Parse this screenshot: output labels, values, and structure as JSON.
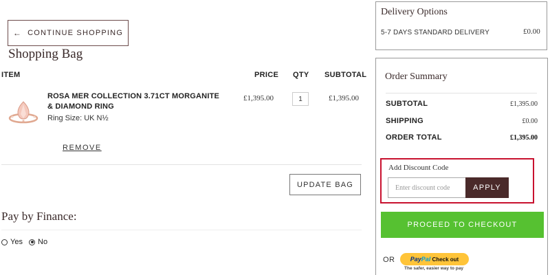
{
  "left": {
    "continue_label": "CONTINUE SHOPPING",
    "title": "Shopping Bag",
    "headers": {
      "item": "ITEM",
      "price": "PRICE",
      "qty": "QTY",
      "subtotal": "SUBTOTAL"
    },
    "item": {
      "name": "ROSA MER COLLECTION 3.71CT MORGANITE & DIAMOND RING",
      "ring_size": "Ring Size:  UK N½",
      "price": "£1,395.00",
      "qty": "1",
      "subtotal": "£1,395.00",
      "remove_label": "REMOVE"
    },
    "update_label": "UPDATE BAG",
    "finance_title": "Pay by Finance:",
    "finance_options": [
      {
        "label": "Yes",
        "checked": false
      },
      {
        "label": "No",
        "checked": true
      }
    ]
  },
  "delivery": {
    "title": "Delivery Options",
    "option": "5-7 DAYS STANDARD DELIVERY",
    "price": "£0.00"
  },
  "summary": {
    "title": "Order Summary",
    "rows": [
      {
        "label": "SUBTOTAL",
        "value": "£1,395.00"
      },
      {
        "label": "SHIPPING",
        "value": "£0.00"
      },
      {
        "label": "ORDER TOTAL",
        "value": "£1,395.00"
      }
    ],
    "discount_label": "Add Discount Code",
    "discount_placeholder": "Enter discount code",
    "apply_label": "APPLY",
    "checkout_label": "PROCEED TO CHECKOUT",
    "or_label": "OR",
    "paypal": {
      "pay": "Pay",
      "pal": "Pal",
      "checkout": "Check out",
      "tagline": "The safer, easier way to pay"
    }
  },
  "colors": {
    "accent": "#4a2a2a",
    "checkout": "#56c131",
    "highlight": "#c8102e",
    "paypal": "#ffc439"
  }
}
